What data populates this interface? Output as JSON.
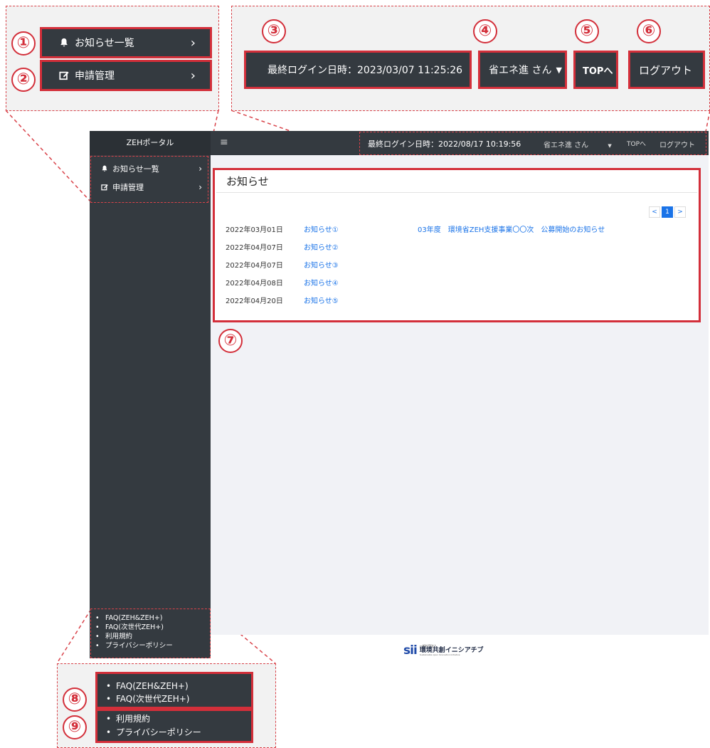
{
  "zoom_sidebar": {
    "items": [
      {
        "label": "お知らせ一覧",
        "icon": "bell-icon"
      },
      {
        "label": "申請管理",
        "icon": "edit-icon"
      }
    ]
  },
  "zoom_header": {
    "last_login": "最終ログイン日時：2023/03/07 11:25:26",
    "user": "省エネ進 さん",
    "top_link": "TOPへ",
    "logout": "ログアウト"
  },
  "annotations": [
    "①",
    "②",
    "③",
    "④",
    "⑤",
    "⑥",
    "⑦",
    "⑧",
    "⑨"
  ],
  "app": {
    "brand": "ZEHポータル",
    "menu_icon": "≡",
    "last_login": "最終ログイン日時：2022/08/17 10:19:56",
    "user": "省エネ進 さん",
    "top_link": "TOPへ",
    "logout": "ログアウト",
    "sidebar": [
      {
        "label": "お知らせ一覧",
        "icon": "bell-icon"
      },
      {
        "label": "申請管理",
        "icon": "edit-icon"
      }
    ],
    "notices_title": "お知らせ",
    "pagination": {
      "prev": "<",
      "current": "1",
      "next": ">"
    },
    "notices": [
      {
        "date": "2022年03月01日",
        "link": "お知らせ①",
        "title": "03年度　環境省ZEH支援事業〇〇次　公募開始のお知らせ"
      },
      {
        "date": "2022年04月07日",
        "link": "お知らせ②",
        "title": ""
      },
      {
        "date": "2022年04月07日",
        "link": "お知らせ③",
        "title": ""
      },
      {
        "date": "2022年04月08日",
        "link": "お知らせ④",
        "title": ""
      },
      {
        "date": "2022年04月20日",
        "link": "お知らせ⑤",
        "title": ""
      }
    ],
    "footer_links": [
      "FAQ(ZEH&ZEH+)",
      "FAQ(次世代ZEH+)",
      "利用規約",
      "プライバシーポリシー"
    ],
    "logo": {
      "mark": "sii",
      "org_small": "一般社団法人",
      "org": "環境共創イニシアチブ",
      "sub": "Sustainable open Innovation Initiative"
    }
  },
  "zoom_footer": {
    "faq_links": [
      "FAQ(ZEH&ZEH+)",
      "FAQ(次世代ZEH+)"
    ],
    "policy_links": [
      "利用規約",
      "プライバシーポリシー"
    ]
  },
  "colors": {
    "accent_red": "#d32f3a",
    "sidebar_dark": "#343a40",
    "link_blue": "#1a73e8"
  }
}
